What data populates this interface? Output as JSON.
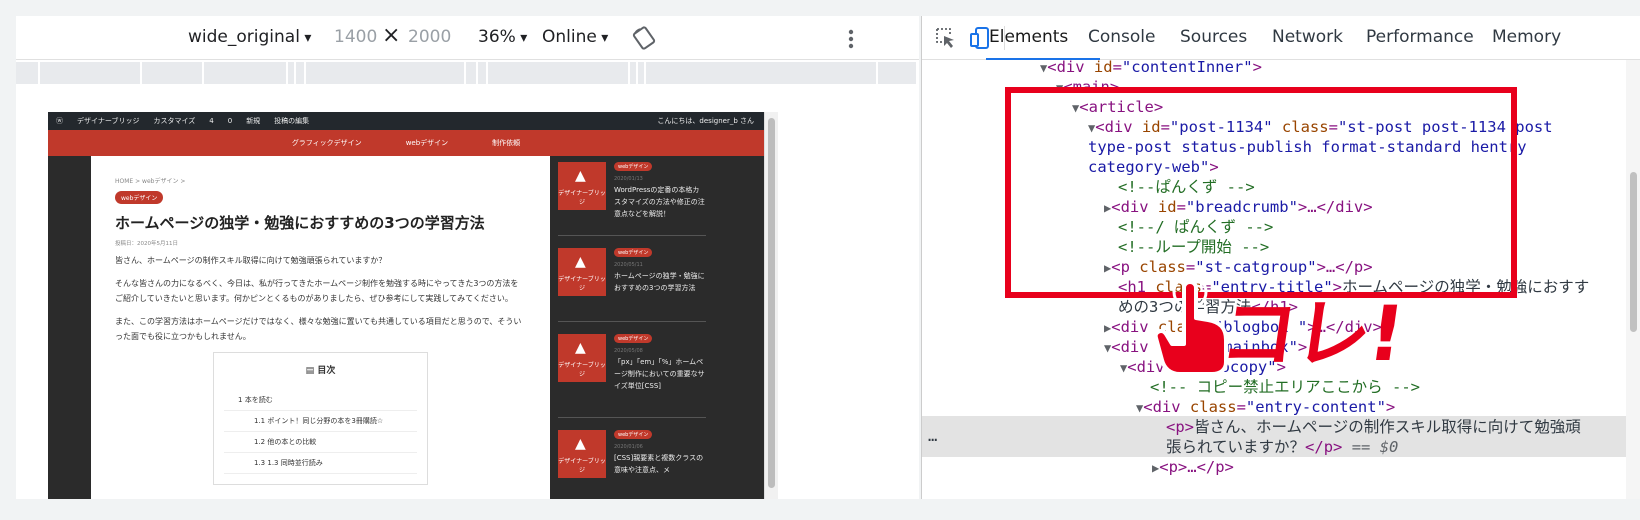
{
  "device_toolbar": {
    "device": "wide_original",
    "width": "1400",
    "times": "×",
    "height": "2000",
    "zoom": "36%",
    "network": "Online"
  },
  "website": {
    "adminbar": {
      "site": "デザイナーブリッジ",
      "customize": "カスタマイズ",
      "updates": "4",
      "comments": "0",
      "new": "新規",
      "edit": "投稿の編集",
      "greeting": "こんにちは、designer_b さん"
    },
    "nav": [
      "グラフィックデザイン",
      "webデザイン",
      "制作依頼"
    ],
    "breadcrumb": "HOME > webデザイン >",
    "category": "webデザイン",
    "title": "ホームページの独学・勉強におすすめの3つの学習方法",
    "date": "投稿日：2020年5月11日",
    "paragraphs": [
      "皆さん、ホームページの制作スキル取得に向けて勉強頑張られていますか？",
      "そんな皆さんの力になるべく、今日は、私が行ってきたホームページ制作を勉強する時にやってきた3つの方法をご紹介していきたいと思います。何かピンとくるものがありましたら、ぜひ参考にして実践してみてください。",
      "また、この学習方法はホームページだけではなく、様々な勉強に置いても共通している項目だと思うので、そういった面でも役に立つかもしれません。"
    ],
    "toc": {
      "title": "目次",
      "items": [
        {
          "num": "1",
          "text": "本を読む"
        },
        {
          "num": "1.1",
          "text": "ポイント！同じ分野の本を3冊購読☆"
        },
        {
          "num": "1.2",
          "text": "他の本との比較"
        },
        {
          "num": "1.3",
          "text": "1.3 同時並行読み"
        }
      ]
    },
    "sidebar": [
      {
        "badge": "webデザイン",
        "date": "2020/01/13",
        "title": "WordPressの定番の本格カスタマイズの方法や修正の注意点などを解説！",
        "logo": "デザイナーブリッジ"
      },
      {
        "badge": "webデザイン",
        "date": "2020/05/11",
        "title": "ホームページの独学・勉強におすすめの3つの学習方法",
        "logo": "デザイナーブリッジ"
      },
      {
        "badge": "webデザイン",
        "date": "2020/05/08",
        "title": "「px」「em」「%」ホームページ制作においての重要なサイズ単位[CSS]",
        "logo": "デザイナーブリッジ"
      },
      {
        "badge": "webデザイン",
        "date": "2020/01/06",
        "title": "[CSS]親要素と複数クラスの意味や注意点、メ",
        "logo": "デザイナーブリッジ"
      }
    ]
  },
  "devtools": {
    "tabs": [
      "Elements",
      "Console",
      "Sources",
      "Network",
      "Performance",
      "Memory"
    ],
    "active_tab": "Elements",
    "ellipsis": "…",
    "tree": [
      {
        "tag_open": "<div ",
        "attr": "id",
        "val": "\"contentInner\"",
        "close": ">"
      },
      {
        "tag_open": "<main>"
      },
      {
        "tag_open": "<article>"
      },
      {
        "tag_open": "<div ",
        "attr": "id",
        "val": "\"post-1134\"",
        "attr2": "class",
        "val2": "\"st-post post-1134 post",
        "cont1": "type-post status-publish format-standard hentry",
        "cont2": "category-web\"",
        "close": ">"
      },
      {
        "comment": "<!--ぱんくず -->"
      },
      {
        "tag_open": "<div ",
        "attr": "id",
        "val": "\"breadcrumb\"",
        "close": ">…</div>"
      },
      {
        "comment": "<!--/ ぱんくず -->"
      },
      {
        "comment": "<!--ループ開始 -->"
      },
      {
        "tag_open": "<p ",
        "attr": "class",
        "val": "\"st-catgroup\"",
        "close": ">…</p>"
      },
      {
        "tag_open": "<h1 ",
        "attr": "class",
        "val": "\"entry-title\"",
        "close": ">",
        "text": "ホームページの独学・勉強におすす",
        "cont1": "めの3つの学習方法",
        "close2": "</h1>"
      },
      {
        "tag_open": "<div ",
        "attr": "class",
        "val": "\"blogbox \"",
        "close": ">…</div>"
      },
      {
        "tag_open": "<div ",
        "attr": "class",
        "val": "\"mainbox\"",
        "close": ">"
      },
      {
        "tag_open": "<div ",
        "attr": "id",
        "val": "\"nocopy\"",
        "close": ">"
      },
      {
        "comment": "<!-- コピー禁止エリアここから -->"
      },
      {
        "tag_open": "<div ",
        "attr": "class",
        "val": "\"entry-content\"",
        "close": ">"
      },
      {
        "tag_open": "<p>",
        "text": "皆さん、ホームページの制作スキル取得に向けて勉強頑",
        "cont1": "張られていますか？",
        "close": "</p>",
        "eq": " == $0"
      },
      {
        "tag_open": "<p>",
        "close": "…</p>"
      }
    ]
  },
  "annotation": {
    "label": "コレ!",
    "color": "#e8001c"
  }
}
